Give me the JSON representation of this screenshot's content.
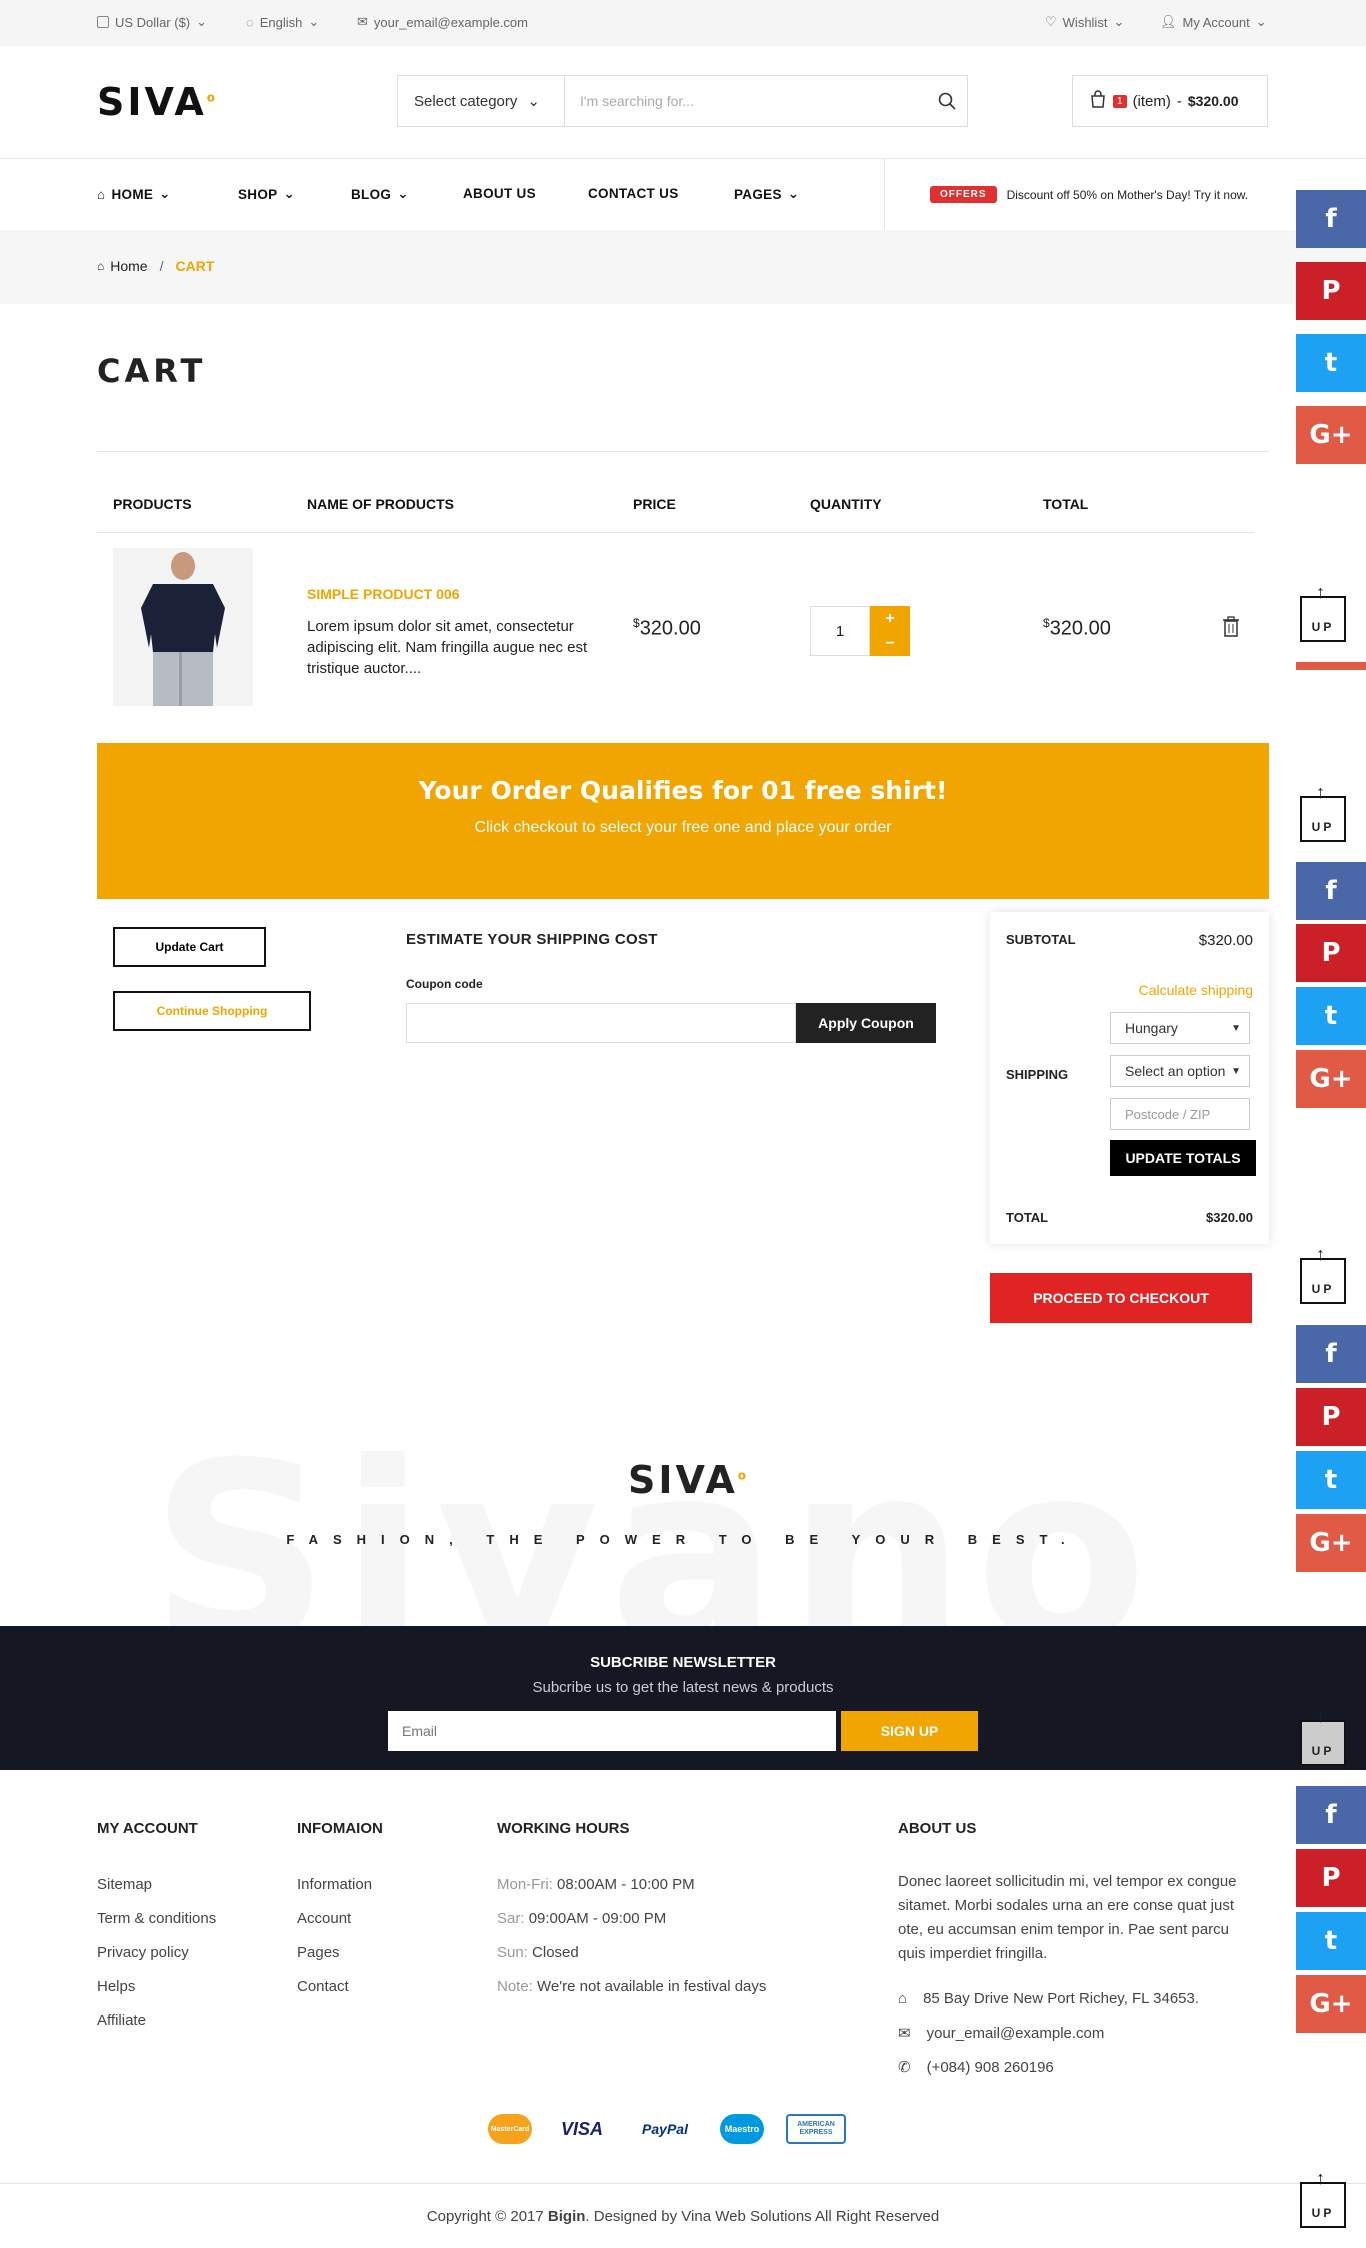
{
  "topbar": {
    "currency": "US Dollar ($)",
    "language": "English",
    "email": "your_email@example.com",
    "wishlist": "Wishlist",
    "account": "My Account"
  },
  "header": {
    "logo": "SIVA",
    "category_select": "Select category",
    "search_placeholder": "I'm searching for...",
    "cart_count": "1",
    "cart_label": "(item)",
    "cart_sep": "-",
    "cart_total": "$320.00"
  },
  "nav": {
    "items": [
      "HOME",
      "SHOP",
      "BLOG",
      "ABOUT US",
      "CONTACT US",
      "PAGES"
    ],
    "offers_tag": "OFFERS",
    "offers_text": "Discount off 50% on Mother's Day! Try it now."
  },
  "breadcrumb": {
    "home": "Home",
    "sep": "/",
    "current": "CART"
  },
  "page_title": "CART",
  "table": {
    "headers": [
      "PRODUCTS",
      "NAME OF PRODUCTS",
      "PRICE",
      "QUANTITY",
      "TOTAL"
    ],
    "row": {
      "name": "SIMPLE PRODUCT 006",
      "desc": "Lorem ipsum dolor sit amet, consectetur adipiscing elit. Nam fringilla augue nec est tristique auctor....",
      "price_cur": "$",
      "price": "320.00",
      "qty": "1",
      "plus": "+",
      "minus": "−",
      "total_cur": "$",
      "total": "320.00"
    }
  },
  "promo": {
    "headline": "Your Order Qualifies for 01 free shirt!",
    "sub": "Click checkout to select your free one and place your order"
  },
  "actions": {
    "update_cart": "Update Cart",
    "continue": "Continue Shopping"
  },
  "estimate": {
    "title": "ESTIMATE YOUR SHIPPING COST",
    "coupon_label": "Coupon code",
    "coupon_value": "",
    "apply": "Apply Coupon"
  },
  "totals": {
    "subtotal_label": "SUBTOTAL",
    "subtotal": "$320.00",
    "calc_shipping": "Calculate shipping",
    "country": "Hungary",
    "state": "Select an option",
    "postcode_placeholder": "Postcode / ZIP",
    "shipping_label": "SHIPPING",
    "update_totals": "UPDATE TOTALS",
    "total_label": "TOTAL",
    "total": "$320.00"
  },
  "checkout": "PROCEED TO CHECKOUT",
  "footer_brand": {
    "ghost": "Sivano",
    "logo": "SIVA",
    "tagline": "FASHION, THE POWER TO BE YOUR BEST."
  },
  "newsletter": {
    "title": "SUBCRIBE NEWSLETTER",
    "sub": "Subcribe us to get the latest news & products",
    "placeholder": "Email",
    "button": "SIGN UP"
  },
  "footer": {
    "my_account": {
      "title": "MY ACCOUNT",
      "links": [
        "Sitemap",
        "Term & conditions",
        "Privacy policy",
        "Helps",
        "Affiliate"
      ]
    },
    "info": {
      "title": "INFOMAION",
      "links": [
        "Information",
        "Account",
        "Pages",
        "Contact"
      ]
    },
    "hours": {
      "title": "WORKING HOURS",
      "rows": [
        {
          "k": "Mon-Fri:",
          "v": "08:00AM - 10:00 PM"
        },
        {
          "k": "Sar:",
          "v": "09:00AM - 09:00 PM"
        },
        {
          "k": "Sun:",
          "v": "Closed"
        },
        {
          "k": "Note:",
          "v": "We're not available in festival days"
        }
      ]
    },
    "about": {
      "title": "ABOUT US",
      "text": "Donec laoreet sollicitudin mi, vel tempor ex congue sitamet. Morbi sodales urna an ere conse quat just ote, eu accumsan enim tempor in. Pae sent parcu quis imperdiet fringilla.",
      "address": "85 Bay Drive New Port Richey, FL 34653.",
      "email": "your_email@example.com",
      "phone": "(+084) 908 260196"
    }
  },
  "payments": [
    "MasterCard",
    "VISA",
    "PayPal",
    "Maestro",
    "AMERICAN EXPRESS"
  ],
  "copyright": {
    "pre": "Copyright © 2017 ",
    "brand": "Bigin",
    "post": ". Designed by Vina Web Solutions All Right Reserved"
  },
  "social": {
    "facebook": "f",
    "pinterest": "P",
    "twitter": "t",
    "google": "G+",
    "up": "UP"
  },
  "colors": {
    "accent": "#f0a500",
    "checkout": "#e02424",
    "newsletter_bg": "#151823"
  }
}
